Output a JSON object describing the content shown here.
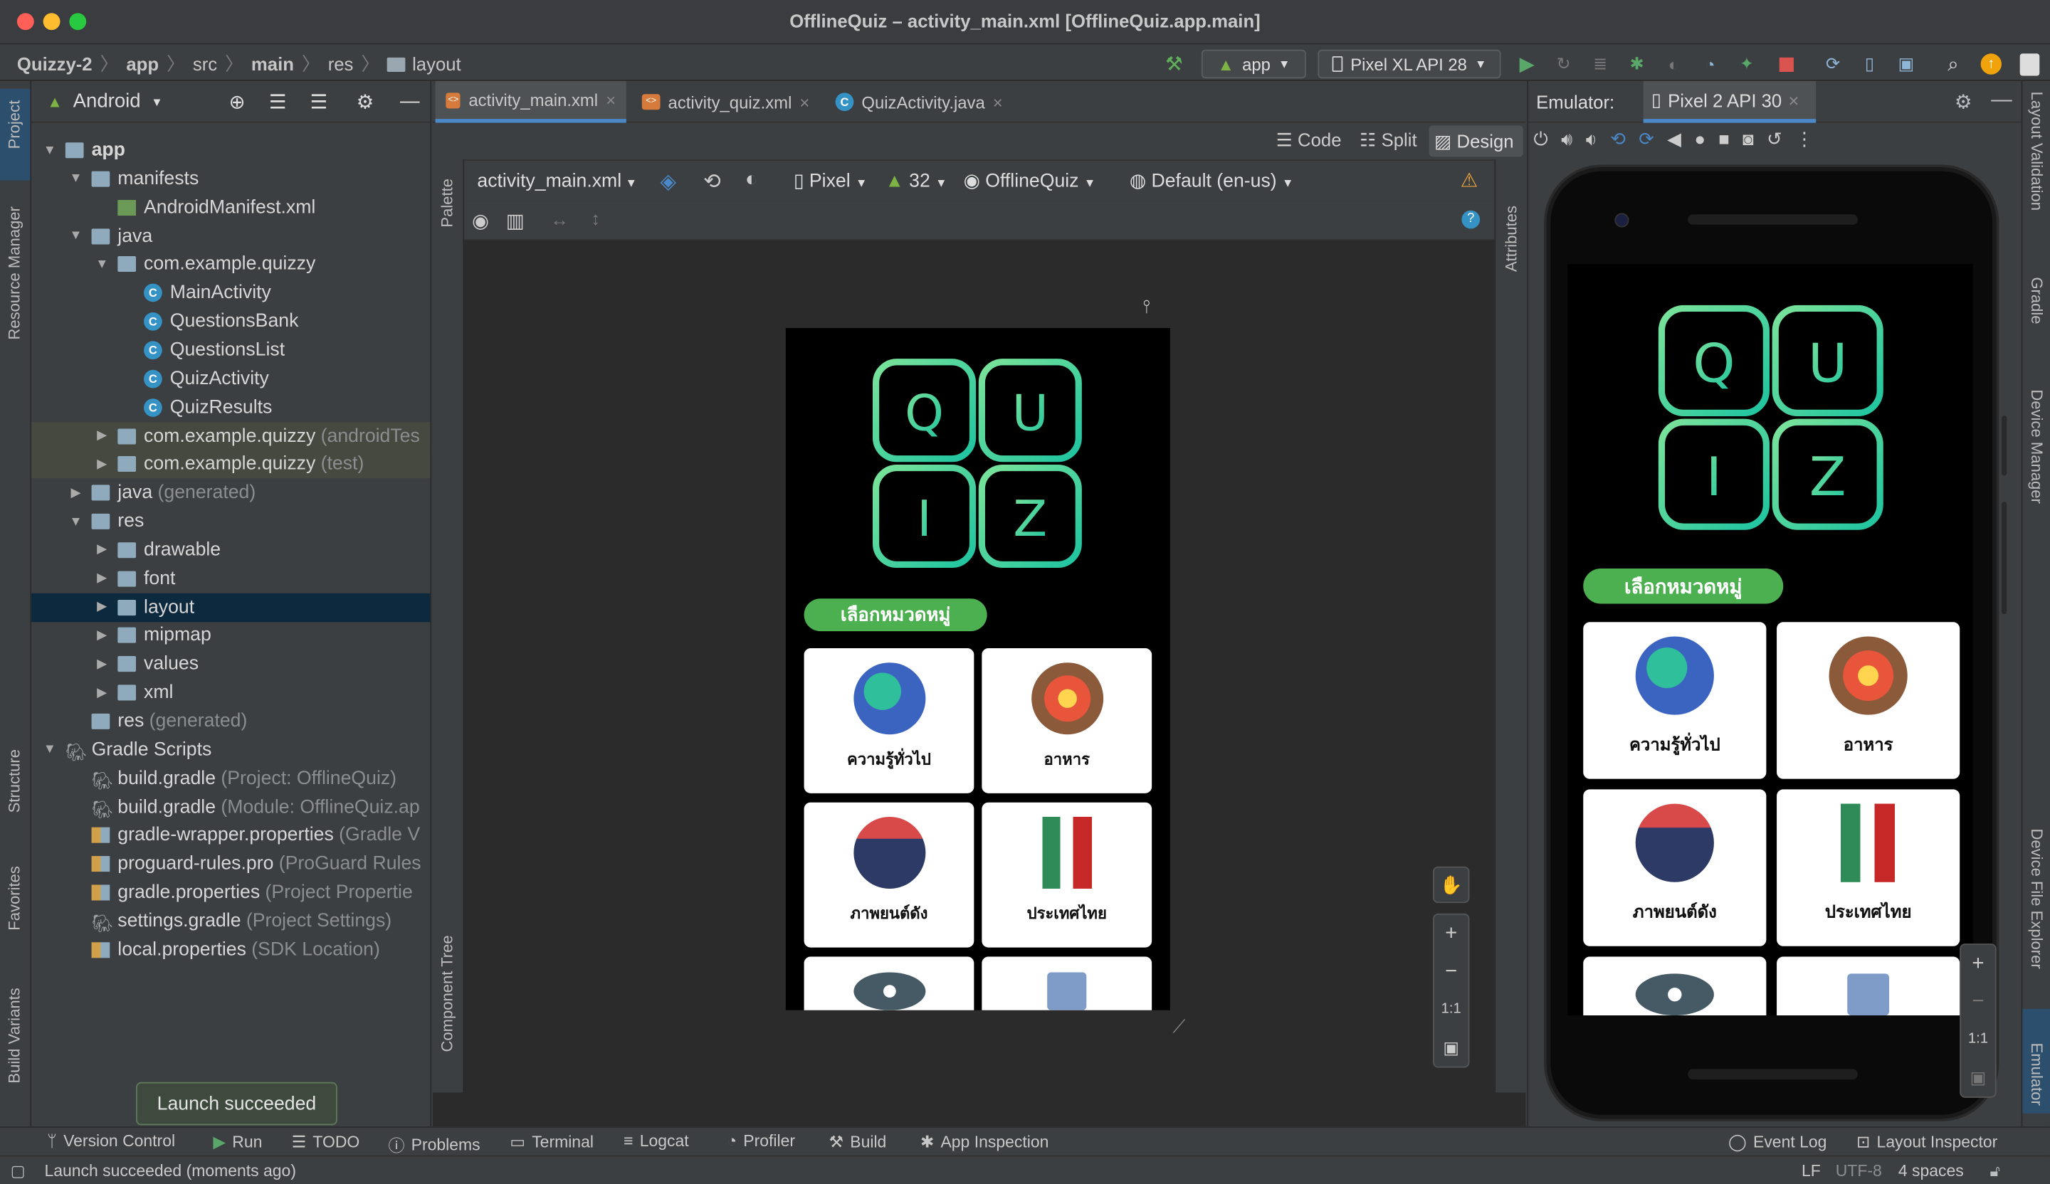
{
  "window": {
    "title": "OfflineQuiz – activity_main.xml [OfflineQuiz.app.main]"
  },
  "breadcrumbs": [
    "Quizzy-2",
    "app",
    "src",
    "main",
    "res",
    "layout"
  ],
  "toolbar": {
    "run_config": "app",
    "device": "Pixel XL API 28"
  },
  "left_strip": {
    "project": "Project",
    "resource_manager": "Resource Manager",
    "structure": "Structure",
    "favorites": "Favorites",
    "build_variants": "Build Variants"
  },
  "project_panel": {
    "view_mode": "Android",
    "tree": [
      {
        "label": "app",
        "muted": ""
      },
      {
        "label": "manifests",
        "muted": ""
      },
      {
        "label": "AndroidManifest.xml",
        "muted": ""
      },
      {
        "label": "java",
        "muted": ""
      },
      {
        "label": "com.example.quizzy",
        "muted": ""
      },
      {
        "label": "MainActivity",
        "muted": ""
      },
      {
        "label": "QuestionsBank",
        "muted": ""
      },
      {
        "label": "QuestionsList",
        "muted": ""
      },
      {
        "label": "QuizActivity",
        "muted": ""
      },
      {
        "label": "QuizResults",
        "muted": ""
      },
      {
        "label": "com.example.quizzy",
        "muted": "(androidTes"
      },
      {
        "label": "com.example.quizzy",
        "muted": "(test)"
      },
      {
        "label": "java",
        "muted": "(generated)"
      },
      {
        "label": "res",
        "muted": ""
      },
      {
        "label": "drawable",
        "muted": ""
      },
      {
        "label": "font",
        "muted": ""
      },
      {
        "label": "layout",
        "muted": ""
      },
      {
        "label": "mipmap",
        "muted": ""
      },
      {
        "label": "values",
        "muted": ""
      },
      {
        "label": "xml",
        "muted": ""
      },
      {
        "label": "res",
        "muted": "(generated)"
      },
      {
        "label": "Gradle Scripts",
        "muted": ""
      },
      {
        "label": "build.gradle",
        "muted": "(Project: OfflineQuiz)"
      },
      {
        "label": "build.gradle",
        "muted": "(Module: OfflineQuiz.ap"
      },
      {
        "label": "gradle-wrapper.properties",
        "muted": "(Gradle V"
      },
      {
        "label": "proguard-rules.pro",
        "muted": "(ProGuard Rules"
      },
      {
        "label": "gradle.properties",
        "muted": "(Project Propertie"
      },
      {
        "label": "settings.gradle",
        "muted": "(Project Settings)"
      },
      {
        "label": "local.properties",
        "muted": "(SDK Location)"
      }
    ]
  },
  "editor_tabs": [
    "activity_main.xml",
    "activity_quiz.xml",
    "QuizActivity.java"
  ],
  "view_modes": {
    "code": "Code",
    "split": "Split",
    "design": "Design"
  },
  "design_toolbar": {
    "file": "activity_main.xml",
    "device": "Pixel",
    "api": "32",
    "theme": "OfflineQuiz",
    "locale": "Default (en-us)"
  },
  "side_labels": {
    "palette": "Palette",
    "component_tree": "Component Tree",
    "attributes": "Attributes"
  },
  "zoom": {
    "fit": "1:1"
  },
  "app_screen": {
    "logo_letters": [
      "Q",
      "U",
      "I",
      "Z"
    ],
    "category_header": "เลือกหมวดหมู่",
    "categories": [
      "ความรู้ทั่วไป",
      "อาหาร",
      "ภาพยนต์ดัง",
      "ประเทศไทย"
    ]
  },
  "emulator": {
    "label": "Emulator:",
    "device": "Pixel 2 API 30"
  },
  "right_strip": {
    "layout_validation": "Layout Validation",
    "gradle": "Gradle",
    "device_manager": "Device Manager",
    "device_file_explorer": "Device File Explorer",
    "emulator": "Emulator"
  },
  "toast": "Launch succeeded",
  "bottom_tools": [
    "Version Control",
    "Run",
    "TODO",
    "Problems",
    "Terminal",
    "Logcat",
    "Profiler",
    "Build",
    "App Inspection"
  ],
  "bottom_right": [
    "Event Log",
    "Layout Inspector"
  ],
  "status": {
    "message": "Launch succeeded (moments ago)",
    "line_sep": "LF",
    "encoding": "UTF-8",
    "indent": "4 spaces"
  },
  "colors": {
    "accent": "#4a88c7",
    "pill": "#4caf50",
    "logo_gradient_start": "#76e39a",
    "logo_gradient_end": "#23c4a0"
  }
}
